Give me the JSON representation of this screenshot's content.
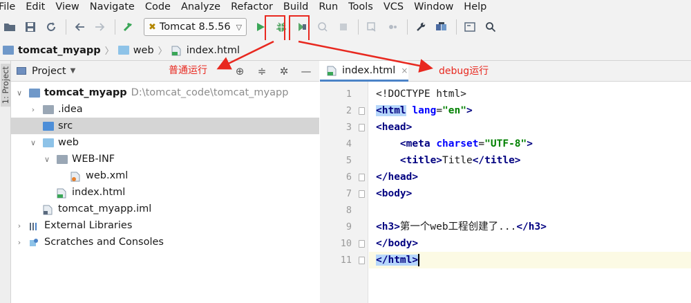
{
  "menu": [
    "File",
    "Edit",
    "View",
    "Navigate",
    "Code",
    "Analyze",
    "Refactor",
    "Build",
    "Run",
    "Tools",
    "VCS",
    "Window",
    "Help"
  ],
  "toolbar": {
    "run_config": "Tomcat 8.5.56"
  },
  "breadcrumb": {
    "project": "tomcat_myapp",
    "folder": "web",
    "file": "index.html"
  },
  "side_strip_label": "1: Project",
  "project_panel": {
    "title": "Project",
    "tree": {
      "root_name": "tomcat_myapp",
      "root_path": "D:\\tomcat_code\\tomcat_myapp",
      "idea": ".idea",
      "src": "src",
      "web": "web",
      "webinf": "WEB-INF",
      "webxml": "web.xml",
      "indexhtml": "index.html",
      "iml": "tomcat_myapp.iml",
      "extlibs": "External Libraries",
      "scratches": "Scratches and Consoles"
    }
  },
  "annotations": {
    "normal_run": "普通运行",
    "debug_run": "debug运行"
  },
  "editor": {
    "tab_label": "index.html",
    "line_numbers": [
      "1",
      "2",
      "3",
      "4",
      "5",
      "6",
      "7",
      "8",
      "9",
      "10",
      "11"
    ],
    "code": {
      "l1": "<!DOCTYPE html>",
      "l2_tag": "<html",
      "l2_attr": "lang",
      "l2_val": "\"en\"",
      "l2_end": ">",
      "l3": "<head>",
      "l4_tag": "<meta",
      "l4_attr": "charset",
      "l4_val": "\"UTF-8\"",
      "l4_end": ">",
      "l5_open": "<title>",
      "l5_text": "Title",
      "l5_close": "</title>",
      "l6": "</head>",
      "l7": "<body>",
      "l9_open": "<h3>",
      "l9_text": "第一个web工程创建了...",
      "l9_close": "</h3>",
      "l10": "</body>",
      "l11": "</html>"
    }
  },
  "colors": {
    "annotation_red": "#e8281f",
    "run_green": "#3aa657",
    "debug_green": "#59a869"
  }
}
